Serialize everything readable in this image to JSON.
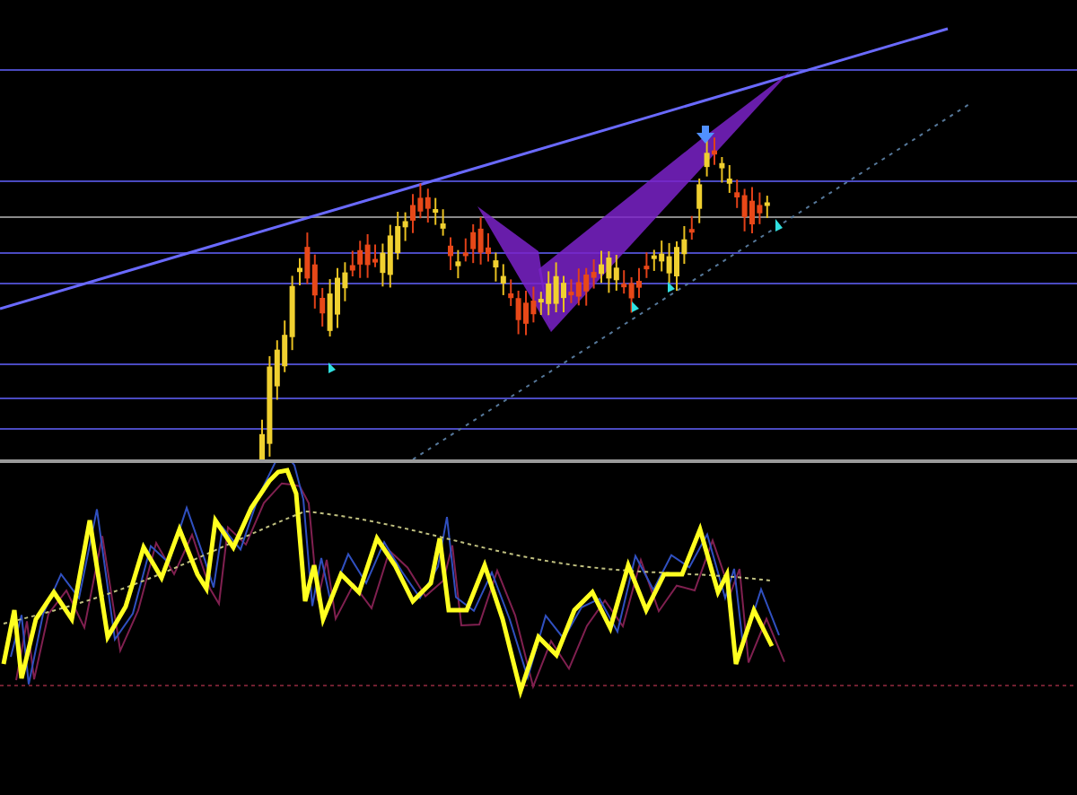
{
  "panels": [
    {
      "kind": "price"
    },
    {
      "kind": "oscillator"
    }
  ]
}
